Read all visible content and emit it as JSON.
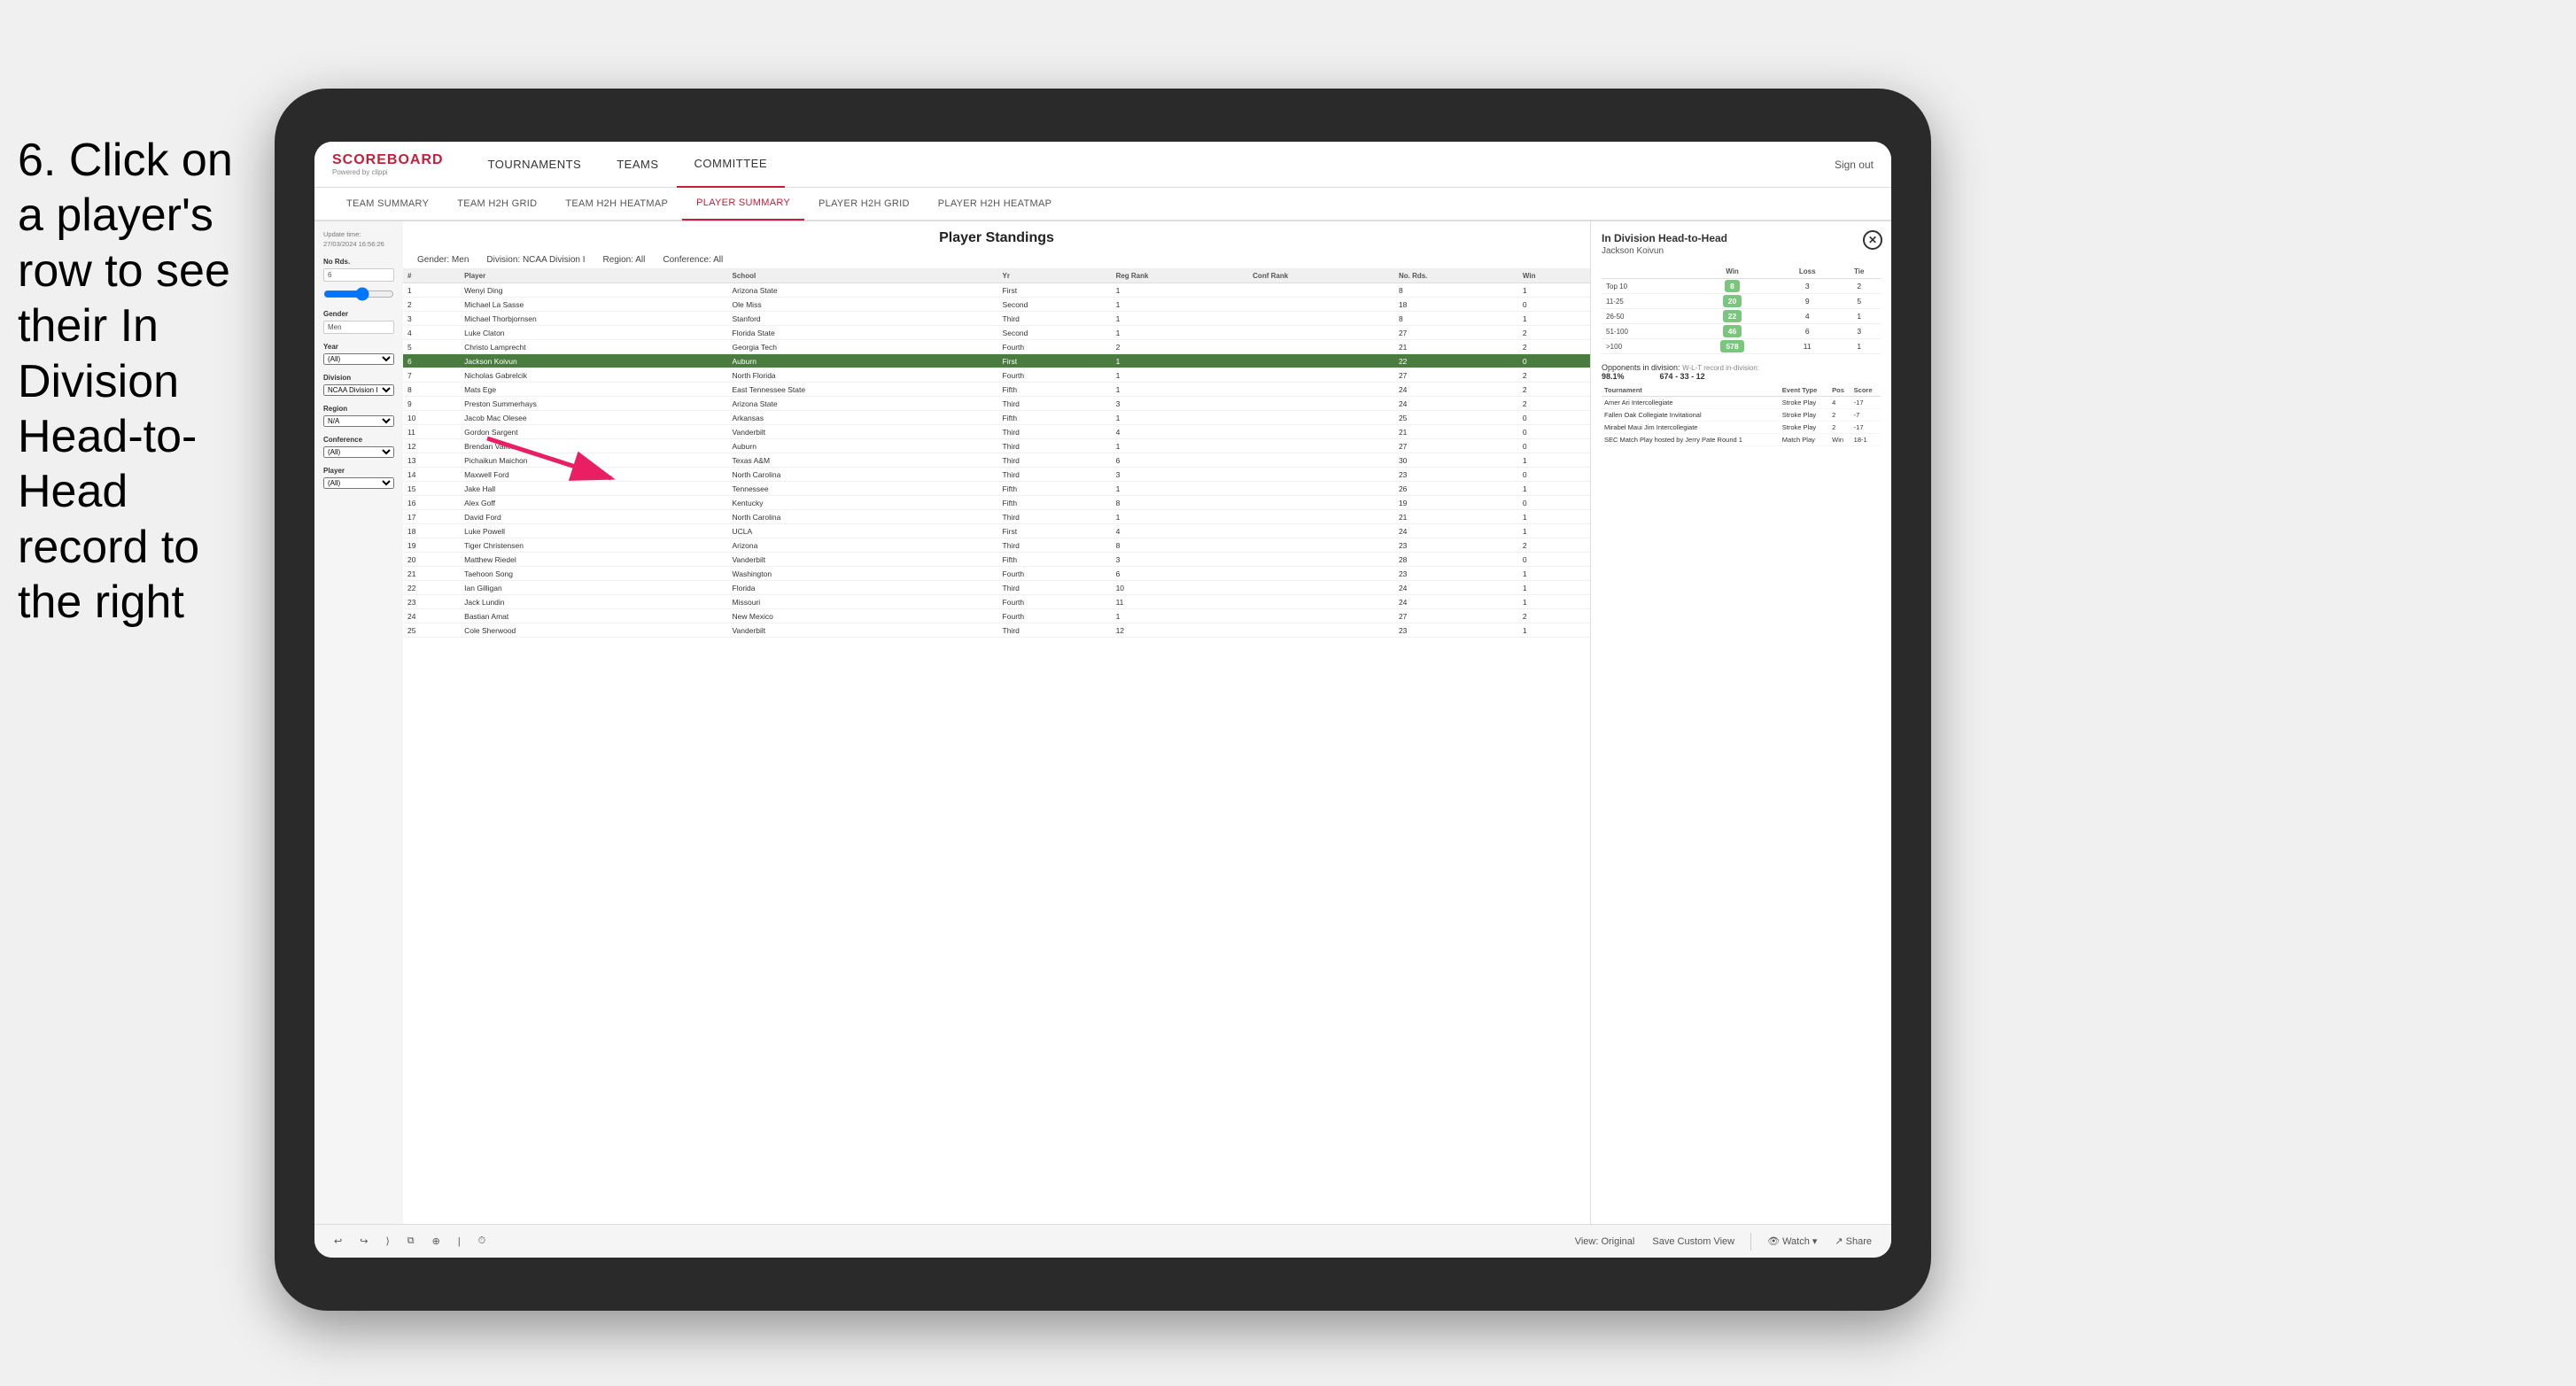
{
  "instruction": {
    "text": "6. Click on a player's row to see their In Division Head-to-Head record to the right"
  },
  "nav": {
    "logo": "SCOREBOARD",
    "logo_sub": "Powered by clippi",
    "items": [
      "TOURNAMENTS",
      "TEAMS",
      "COMMITTEE"
    ],
    "active_nav": "COMMITTEE",
    "sign_out": "Sign out"
  },
  "sub_nav": {
    "items": [
      "TEAM SUMMARY",
      "TEAM H2H GRID",
      "TEAM H2H HEATMAP",
      "PLAYER SUMMARY",
      "PLAYER H2H GRID",
      "PLAYER H2H HEATMAP"
    ],
    "active": "PLAYER SUMMARY"
  },
  "sidebar": {
    "update_label": "Update time:",
    "update_time": "27/03/2024 16:56:26",
    "no_rds_label": "No Rds.",
    "no_rds_value": "6",
    "gender_label": "Gender",
    "gender_value": "Men",
    "year_label": "Year",
    "year_value": "(All)",
    "division_label": "Division",
    "division_value": "NCAA Division I",
    "region_label": "Region",
    "region_value": "N/A",
    "conference_label": "Conference",
    "conference_value": "(All)",
    "player_label": "Player",
    "player_value": "(All)"
  },
  "standings": {
    "title": "Player Standings",
    "filters": {
      "gender": "Men",
      "division": "NCAA Division I",
      "region": "All",
      "conference": "All"
    },
    "columns": [
      "#",
      "Player",
      "School",
      "Yr",
      "Reg Rank",
      "Conf Rank",
      "No. Rds.",
      "Win"
    ],
    "rows": [
      {
        "rank": 1,
        "player": "Wenyi Ding",
        "school": "Arizona State",
        "yr": "First",
        "reg_rank": 1,
        "conf_rank": "",
        "no_rds": 8,
        "win": 1
      },
      {
        "rank": 2,
        "player": "Michael La Sasse",
        "school": "Ole Miss",
        "yr": "Second",
        "reg_rank": 1,
        "conf_rank": "",
        "no_rds": 18,
        "win": 0
      },
      {
        "rank": 3,
        "player": "Michael Thorbjornsen",
        "school": "Stanford",
        "yr": "Third",
        "reg_rank": 1,
        "conf_rank": "",
        "no_rds": 8,
        "win": 1
      },
      {
        "rank": 4,
        "player": "Luke Claton",
        "school": "Florida State",
        "yr": "Second",
        "reg_rank": 1,
        "conf_rank": "",
        "no_rds": 27,
        "win": 2
      },
      {
        "rank": 5,
        "player": "Christo Lamprecht",
        "school": "Georgia Tech",
        "yr": "Fourth",
        "reg_rank": 2,
        "conf_rank": "",
        "no_rds": 21,
        "win": 2
      },
      {
        "rank": 6,
        "player": "Jackson Koivun",
        "school": "Auburn",
        "yr": "First",
        "reg_rank": 1,
        "conf_rank": "",
        "no_rds": 22,
        "win": 0,
        "highlighted": true
      },
      {
        "rank": 7,
        "player": "Nicholas Gabrelcik",
        "school": "North Florida",
        "yr": "Fourth",
        "reg_rank": 1,
        "conf_rank": "",
        "no_rds": 27,
        "win": 2
      },
      {
        "rank": 8,
        "player": "Mats Ege",
        "school": "East Tennessee State",
        "yr": "Fifth",
        "reg_rank": 1,
        "conf_rank": "",
        "no_rds": 24,
        "win": 2
      },
      {
        "rank": 9,
        "player": "Preston Summerhays",
        "school": "Arizona State",
        "yr": "Third",
        "reg_rank": 3,
        "conf_rank": "",
        "no_rds": 24,
        "win": 2
      },
      {
        "rank": 10,
        "player": "Jacob Mac Olesee",
        "school": "Arkansas",
        "yr": "Fifth",
        "reg_rank": 1,
        "conf_rank": "",
        "no_rds": 25,
        "win": 0
      },
      {
        "rank": 11,
        "player": "Gordon Sargent",
        "school": "Vanderbilt",
        "yr": "Third",
        "reg_rank": 4,
        "conf_rank": "",
        "no_rds": 21,
        "win": 0
      },
      {
        "rank": 12,
        "player": "Brendan Valles",
        "school": "Auburn",
        "yr": "Third",
        "reg_rank": 1,
        "conf_rank": "",
        "no_rds": 27,
        "win": 0
      },
      {
        "rank": 13,
        "player": "Pichaikun Maichon",
        "school": "Texas A&M",
        "yr": "Third",
        "reg_rank": 6,
        "conf_rank": "",
        "no_rds": 30,
        "win": 1
      },
      {
        "rank": 14,
        "player": "Maxwell Ford",
        "school": "North Carolina",
        "yr": "Third",
        "reg_rank": 3,
        "conf_rank": "",
        "no_rds": 23,
        "win": 0
      },
      {
        "rank": 15,
        "player": "Jake Hall",
        "school": "Tennessee",
        "yr": "Fifth",
        "reg_rank": 1,
        "conf_rank": "",
        "no_rds": 26,
        "win": 1
      },
      {
        "rank": 16,
        "player": "Alex Goff",
        "school": "Kentucky",
        "yr": "Fifth",
        "reg_rank": 8,
        "conf_rank": "",
        "no_rds": 19,
        "win": 0
      },
      {
        "rank": 17,
        "player": "David Ford",
        "school": "North Carolina",
        "yr": "Third",
        "reg_rank": 1,
        "conf_rank": "",
        "no_rds": 21,
        "win": 1
      },
      {
        "rank": 18,
        "player": "Luke Powell",
        "school": "UCLA",
        "yr": "First",
        "reg_rank": 4,
        "conf_rank": "",
        "no_rds": 24,
        "win": 1
      },
      {
        "rank": 19,
        "player": "Tiger Christensen",
        "school": "Arizona",
        "yr": "Third",
        "reg_rank": 8,
        "conf_rank": "",
        "no_rds": 23,
        "win": 2
      },
      {
        "rank": 20,
        "player": "Matthew Riedel",
        "school": "Vanderbilt",
        "yr": "Fifth",
        "reg_rank": 3,
        "conf_rank": "",
        "no_rds": 28,
        "win": 0
      },
      {
        "rank": 21,
        "player": "Taehoon Song",
        "school": "Washington",
        "yr": "Fourth",
        "reg_rank": 6,
        "conf_rank": "",
        "no_rds": 23,
        "win": 1
      },
      {
        "rank": 22,
        "player": "Ian Gilligan",
        "school": "Florida",
        "yr": "Third",
        "reg_rank": 10,
        "conf_rank": "",
        "no_rds": 24,
        "win": 1
      },
      {
        "rank": 23,
        "player": "Jack Lundin",
        "school": "Missouri",
        "yr": "Fourth",
        "reg_rank": 11,
        "conf_rank": "",
        "no_rds": 24,
        "win": 1
      },
      {
        "rank": 24,
        "player": "Bastian Amat",
        "school": "New Mexico",
        "yr": "Fourth",
        "reg_rank": 1,
        "conf_rank": "",
        "no_rds": 27,
        "win": 2
      },
      {
        "rank": 25,
        "player": "Cole Sherwood",
        "school": "Vanderbilt",
        "yr": "Third",
        "reg_rank": 12,
        "conf_rank": "",
        "no_rds": 23,
        "win": 1
      }
    ]
  },
  "h2h": {
    "title": "In Division Head-to-Head",
    "player": "Jackson Koivun",
    "table": {
      "columns": [
        "",
        "Win",
        "Loss",
        "Tie"
      ],
      "rows": [
        {
          "label": "Top 10",
          "win": 8,
          "loss": 3,
          "tie": 2
        },
        {
          "label": "11-25",
          "win": 20,
          "loss": 9,
          "tie": 5
        },
        {
          "label": "26-50",
          "win": 22,
          "loss": 4,
          "tie": 1
        },
        {
          "label": "51-100",
          "win": 46,
          "loss": 6,
          "tie": 3
        },
        {
          "label": ">100",
          "win": 578,
          "loss": 11,
          "tie": 1
        }
      ]
    },
    "opponents_pct_label": "Opponents in division:",
    "opponents_pct": "98.1%",
    "wlt_label": "W-L-T record in-division:",
    "wlt": "674 - 33 - 12",
    "tournaments_label": "Tournament",
    "event_type_label": "Event Type",
    "pos_label": "Pos",
    "score_label": "Score",
    "tournaments": [
      {
        "name": "Amer Ari Intercollegiate",
        "event_type": "Stroke Play",
        "pos": 4,
        "score": -17
      },
      {
        "name": "Fallen Oak Collegiate Invitational",
        "event_type": "Stroke Play",
        "pos": 2,
        "score": -7
      },
      {
        "name": "Mirabel Maui Jim Intercollegiate",
        "event_type": "Stroke Play",
        "pos": 2,
        "score": -17
      },
      {
        "name": "SEC Match Play hosted by Jerry Pate Round 1",
        "event_type": "Match Play",
        "pos": "Win",
        "score": "18-1"
      }
    ]
  },
  "toolbar": {
    "undo": "↩",
    "redo": "↪",
    "copy": "⧉",
    "view_original": "View: Original",
    "save_custom": "Save Custom View",
    "watch": "Watch ▾",
    "share": "Share"
  }
}
